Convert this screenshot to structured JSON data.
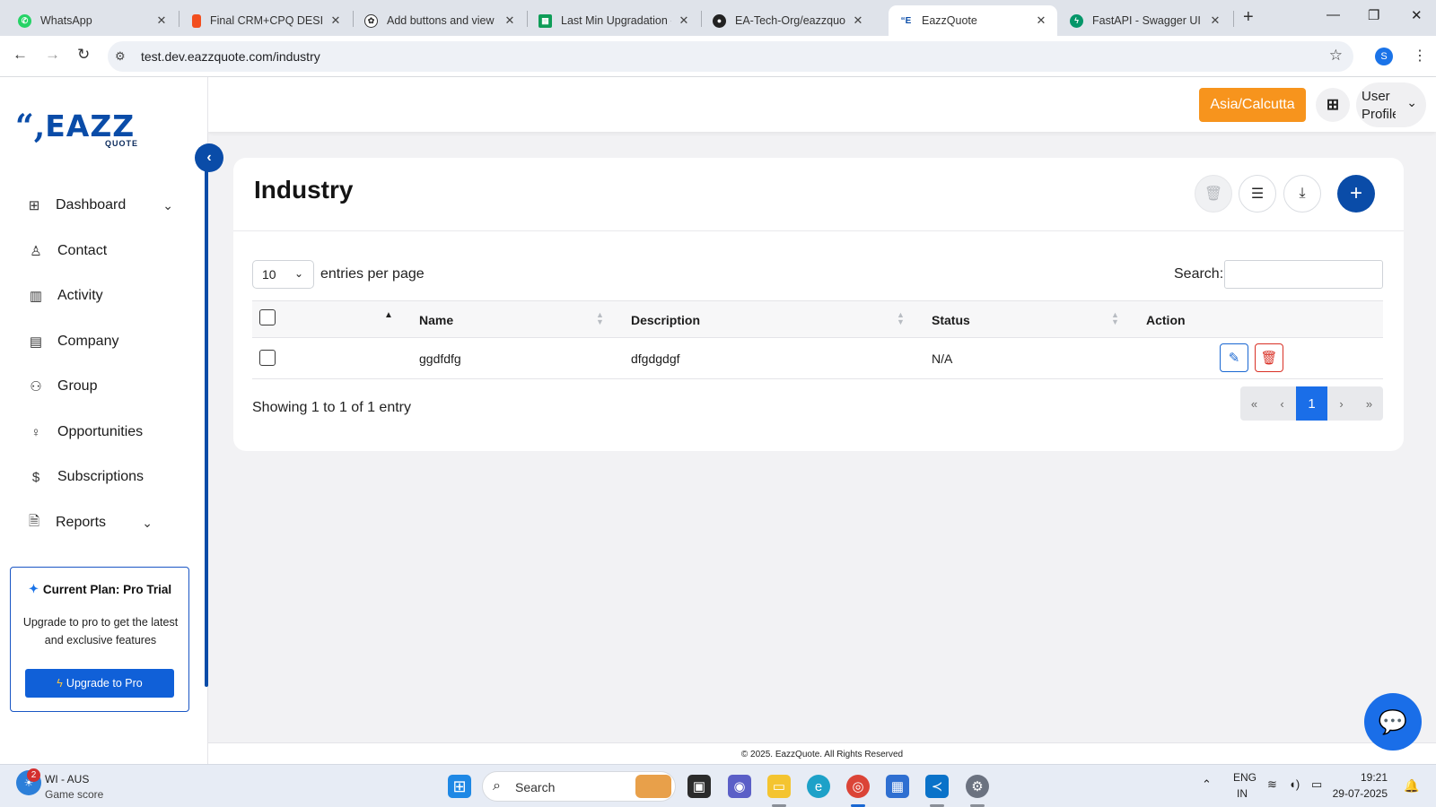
{
  "browser": {
    "tabs": [
      {
        "label": "WhatsApp",
        "icon": "whatsapp-icon",
        "color": "#25d366"
      },
      {
        "label": "Final CRM+CPQ DESIGN",
        "icon": "figma-icon",
        "color": "#f24e1e"
      },
      {
        "label": "Add buttons and view",
        "icon": "openai-icon",
        "color": "#333333"
      },
      {
        "label": "Last Min Upgradation - ",
        "icon": "sheets-icon",
        "color": "#0f9d58"
      },
      {
        "label": "EA-Tech-Org/eazzquote",
        "icon": "github-icon",
        "color": "#222222"
      },
      {
        "label": "EazzQuote",
        "icon": "eazzquote-icon",
        "color": "#0a4ca8"
      },
      {
        "label": "FastAPI - Swagger UI",
        "icon": "fastapi-icon",
        "color": "#059669"
      }
    ],
    "active_tab_index": 5,
    "url": "test.dev.eazzquote.com/industry",
    "profile_initial": "S"
  },
  "app": {
    "logo": {
      "quotes": "“,",
      "brand": "EAZZ",
      "sub": "QUOTE"
    },
    "sidebar": {
      "items": [
        {
          "label": "Dashboard",
          "icon": "grid-icon",
          "has_children": true
        },
        {
          "label": "Contact",
          "icon": "person-icon",
          "has_children": false
        },
        {
          "label": "Activity",
          "icon": "bar-chart-icon",
          "has_children": false
        },
        {
          "label": "Company",
          "icon": "building-icon",
          "has_children": false
        },
        {
          "label": "Group",
          "icon": "people-icon",
          "has_children": false
        },
        {
          "label": "Opportunities",
          "icon": "lightbulb-icon",
          "has_children": false
        },
        {
          "label": "Subscriptions",
          "icon": "dollar-icon",
          "has_children": false
        },
        {
          "label": "Reports",
          "icon": "document-icon",
          "has_children": true
        }
      ]
    },
    "plan_card": {
      "title": "Current Plan: Pro Trial",
      "description": "Upgrade to pro to get the latest and exclusive features",
      "button_label": "Upgrade to Pro"
    },
    "header": {
      "timezone_label": "Asia/Calcutta",
      "user_image_alt": "User Profile"
    },
    "page": {
      "title": "Industry",
      "toolbar": [
        "delete-selected",
        "filter",
        "download",
        "add"
      ],
      "entries_per_page": "10",
      "entries_label": "entries per page",
      "search_label": "Search:",
      "search_value": "",
      "columns": [
        "Name",
        "Description",
        "Status",
        "Action"
      ],
      "rows": [
        {
          "name": "ggdfdfg",
          "description": "dfgdgdgf",
          "status": "N/A"
        }
      ],
      "info": "Showing 1 to 1 of 1 entry",
      "pagination": {
        "first": "«",
        "prev": "‹",
        "current": "1",
        "next": "›",
        "last": "»"
      }
    },
    "footer": "© 2025. EazzQuote. All Rights Reserved"
  },
  "taskbar": {
    "weather": {
      "badge": "2",
      "title": "WI - AUS",
      "subtitle": "Game score"
    },
    "search_placeholder": "Search",
    "language": {
      "line1": "ENG",
      "line2": "IN"
    },
    "time": "19:21",
    "date": "29-07-2025"
  },
  "colors": {
    "brand_blue": "#0a4ca8",
    "timezone_orange": "#f7941d",
    "pagination_active": "#1a6ee8",
    "delete_red": "#d93025"
  }
}
